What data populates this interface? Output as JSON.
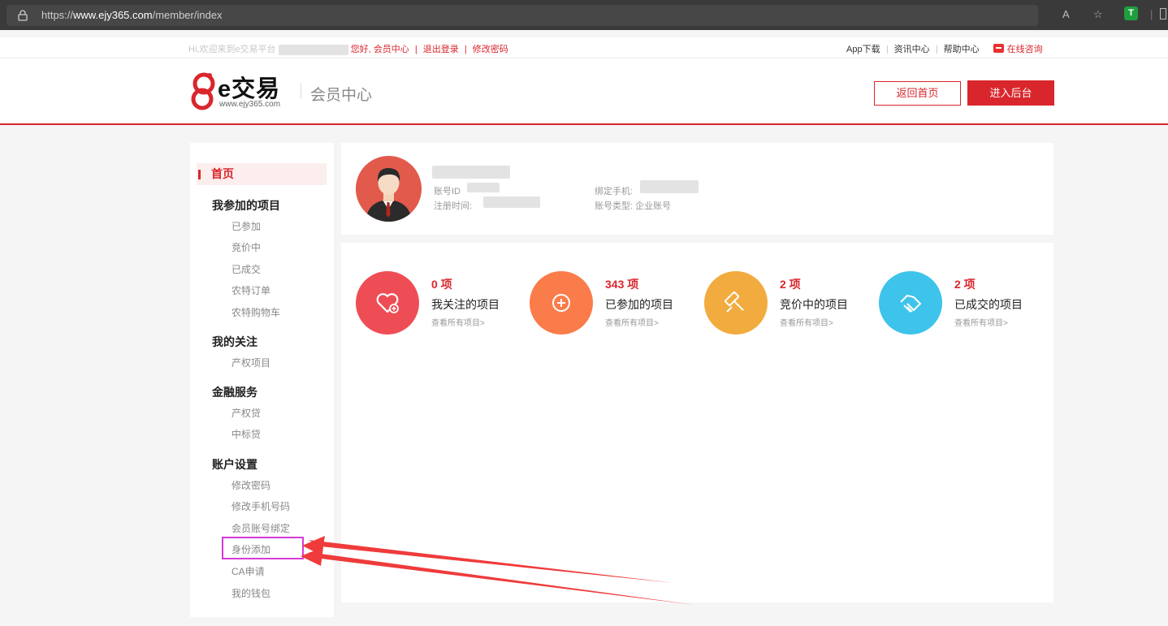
{
  "browser": {
    "url_prefix": "https://",
    "url_host": "www.ejy365.com",
    "url_path": "/member/index"
  },
  "topbar": {
    "greeting": "Hi,欢迎来到e交易平台",
    "hello": "您好,",
    "member_center": "会员中心",
    "sep1": "|",
    "logout": "退出登录",
    "sep2": "|",
    "change_password": "修改密码",
    "app_download": "App下载",
    "news_center": "资讯中心",
    "help_center": "帮助中心",
    "online_consult": "在线咨询"
  },
  "header": {
    "logo_text": "e交易",
    "logo_sub": "www.ejy365.com",
    "title": "会员中心",
    "btn_home": "返回首页",
    "btn_admin": "进入后台"
  },
  "sidebar": {
    "home": "首页",
    "group_projects": "我参加的项目",
    "joined": "已参加",
    "bidding": "竞价中",
    "dealt": "已成交",
    "special_orders": "农特订单",
    "special_cart": "农特购物车",
    "group_follow": "我的关注",
    "property_projects": "产权项目",
    "group_finance": "金融服务",
    "property_loan": "产权贷",
    "bid_loan": "中标贷",
    "group_account": "账户设置",
    "change_password": "修改密码",
    "change_phone": "修改手机号码",
    "bind_account": "会员账号绑定",
    "add_identity": "身份添加",
    "ca_apply": "CA申请",
    "wallet": "我的钱包"
  },
  "profile": {
    "account_id_label": "账号ID",
    "register_time_label": "注册时间:",
    "phone_label": "绑定手机:",
    "account_type_label": "账号类型:",
    "account_type_value": "企业账号"
  },
  "stats": [
    {
      "num": "0 项",
      "title": "我关注的项目",
      "link": "查看所有项目>",
      "color": "#ef4d55"
    },
    {
      "num": "343 项",
      "title": "已参加的项目",
      "link": "查看所有项目>",
      "color": "#f97c4a"
    },
    {
      "num": "2 项",
      "title": "竞价中的项目",
      "link": "查看所有项目>",
      "color": "#f2ab3e"
    },
    {
      "num": "2 项",
      "title": "已成交的项目",
      "link": "查看所有项目>",
      "color": "#3ec3ea"
    }
  ],
  "colors": {
    "brand_red": "#d9262c",
    "highlight_magenta": "#d63ad6",
    "arrow_red": "#ef3b3b"
  }
}
